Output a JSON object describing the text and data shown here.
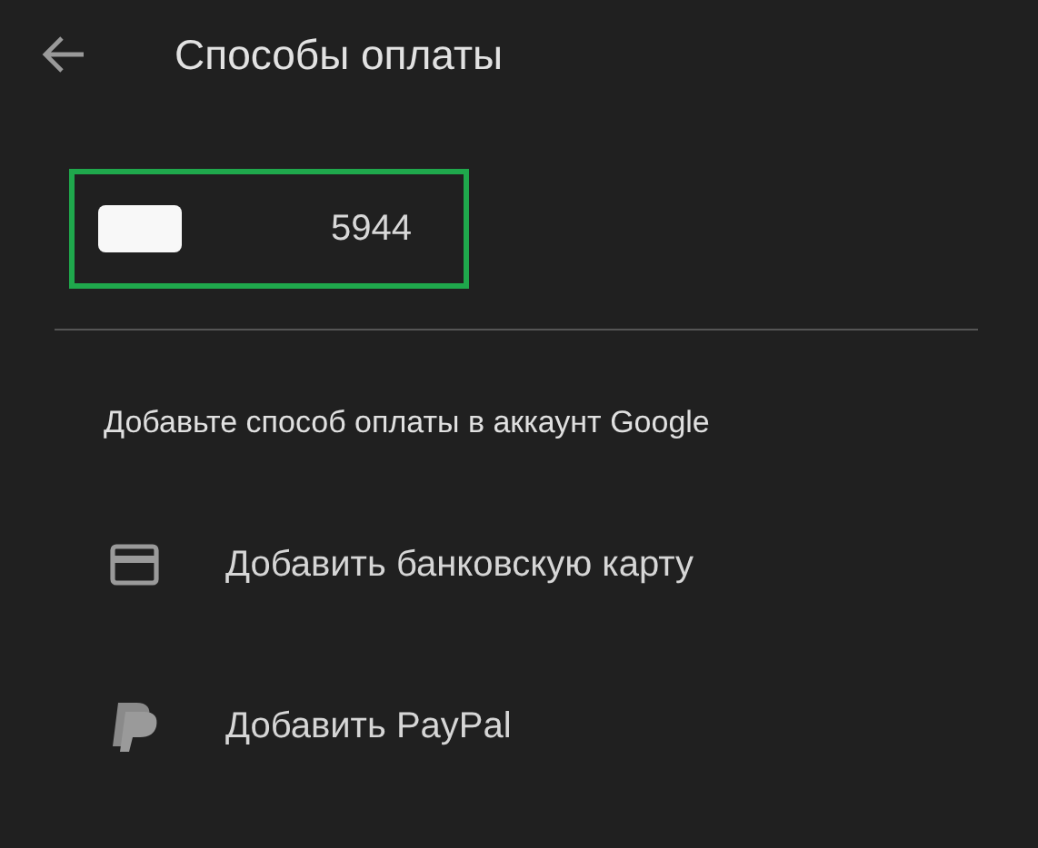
{
  "header": {
    "title": "Способы оплаты"
  },
  "saved_card": {
    "last_digits": "5944",
    "highlighted": true
  },
  "section_title": "Добавьте способ оплаты в аккаунт Google",
  "options": [
    {
      "kind": "card",
      "label": "Добавить банковскую карту"
    },
    {
      "kind": "paypal",
      "label": "Добавить PayPal"
    }
  ]
}
